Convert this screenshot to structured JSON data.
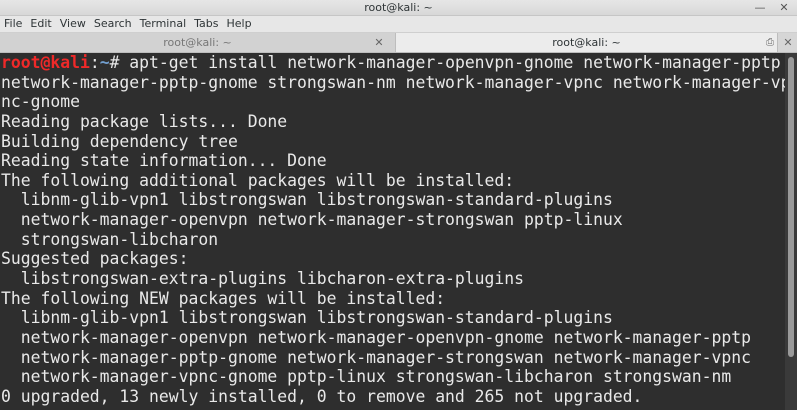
{
  "window": {
    "title": "root@kali: ~",
    "minimize_glyph": "—",
    "close_glyph": "✕"
  },
  "menu": [
    "File",
    "Edit",
    "View",
    "Search",
    "Terminal",
    "Tabs",
    "Help"
  ],
  "tabs": [
    {
      "label": "root@kali: ~",
      "active": false
    },
    {
      "label": "root@kali: ~",
      "active": true
    }
  ],
  "tab_close_glyph": "✕",
  "tab_extra_glyph": "⎙",
  "terminal": {
    "prompt": {
      "user": "root@kali",
      "separator": ":",
      "path": "~",
      "symbol": "#"
    },
    "command": " apt-get install network-manager-openvpn-gnome network-manager-pptp",
    "output": [
      "network-manager-pptp-gnome strongswan-nm network-manager-vpnc network-manager-vp",
      "nc-gnome",
      "Reading package lists... Done",
      "Building dependency tree",
      "Reading state information... Done",
      "The following additional packages will be installed:",
      "  libnm-glib-vpn1 libstrongswan libstrongswan-standard-plugins",
      "  network-manager-openvpn network-manager-strongswan pptp-linux",
      "  strongswan-libcharon",
      "Suggested packages:",
      "  libstrongswan-extra-plugins libcharon-extra-plugins",
      "The following NEW packages will be installed:",
      "  libnm-glib-vpn1 libstrongswan libstrongswan-standard-plugins",
      "  network-manager-openvpn network-manager-openvpn-gnome network-manager-pptp",
      "  network-manager-pptp-gnome network-manager-strongswan network-manager-vpnc",
      "  network-manager-vpnc-gnome pptp-linux strongswan-libcharon strongswan-nm",
      "0 upgraded, 13 newly installed, 0 to remove and 265 not upgraded."
    ]
  }
}
